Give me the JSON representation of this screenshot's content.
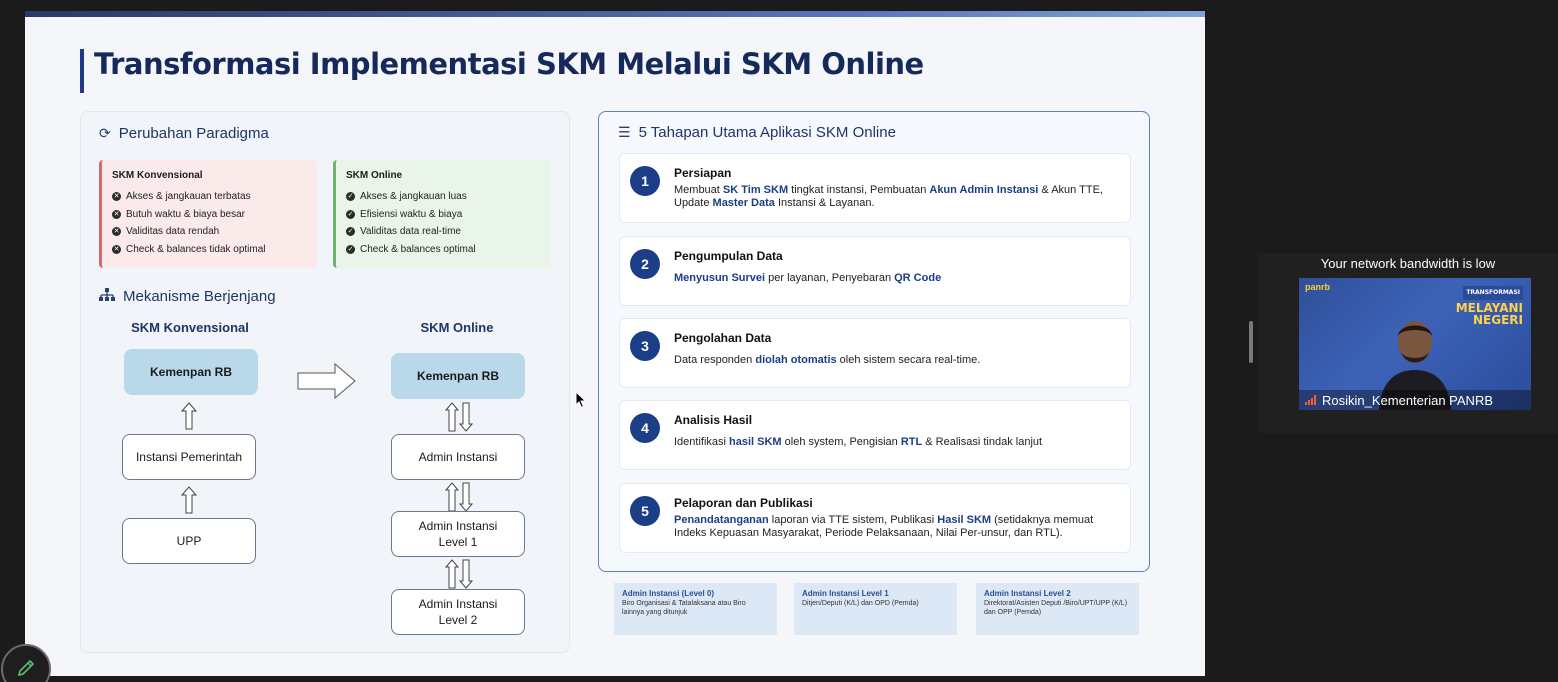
{
  "slide": {
    "title": "Transformasi Implementasi SKM Melalui SKM Online",
    "paradigm": {
      "heading": "Perubahan Paradigma",
      "konvensional": {
        "title": "SKM Konvensional",
        "items": [
          "Akses & jangkauan terbatas",
          "Butuh waktu & biaya besar",
          "Validitas data rendah",
          "Check & balances tidak optimal"
        ]
      },
      "online": {
        "title": "SKM Online",
        "items": [
          "Akses & jangkauan luas",
          "Efisiensi waktu & biaya",
          "Validitas data real-time",
          "Check & balances optimal"
        ]
      }
    },
    "mechanism": {
      "heading": "Mekanisme Berjenjang",
      "left_title": "SKM Konvensional",
      "right_title": "SKM Online",
      "left_boxes": [
        "Kemenpan RB",
        "Instansi Pemerintah",
        "UPP"
      ],
      "right_boxes": [
        "Kemenpan RB",
        "Admin Instansi",
        "Admin Instansi\nLevel 1",
        "Admin Instansi\nLevel 2"
      ]
    },
    "steps_heading": "5 Tahapan Utama Aplikasi SKM Online",
    "steps": [
      {
        "num": "1",
        "title": "Persiapan"
      },
      {
        "num": "2",
        "title": "Pengumpulan Data"
      },
      {
        "num": "3",
        "title": "Pengolahan Data"
      },
      {
        "num": "4",
        "title": "Analisis Hasil"
      },
      {
        "num": "5",
        "title": "Pelaporan dan Publikasi"
      }
    ],
    "step_desc": {
      "s1": {
        "a": "Membuat ",
        "b1": "SK Tim SKM",
        "c": " tingkat instansi, Pembuatan ",
        "b2": "Akun Admin Instansi",
        "d": " & Akun TTE, Update ",
        "b3": "Master Data",
        "e": " Instansi & Layanan."
      },
      "s2": {
        "b1": "Menyusun Survei",
        "a": " per layanan, Penyebaran ",
        "b2": "QR Code"
      },
      "s3": {
        "a": "Data responden ",
        "b1": "diolah otomatis",
        "c": " oleh sistem secara real-time."
      },
      "s4": {
        "a": "Identifikasi ",
        "b1": "hasil SKM",
        "c": " oleh system, Pengisian ",
        "b2": "RTL",
        "d": " & Realisasi tindak lanjut"
      },
      "s5": {
        "b1": "Penandatanganan",
        "a": " laporan via TTE sistem, Publikasi ",
        "b2": "Hasil SKM",
        "c": " (setidaknya memuat Indeks Kepuasan Masyarakat, Periode Pelaksanaan, Nilai Per-unsur, dan RTL)."
      }
    },
    "legend": [
      {
        "title": "Admin Instansi (Level 0)",
        "desc": "Biro Organisasi & Tatalaksana atau Biro lainnya yang ditunjuk"
      },
      {
        "title": "Admin Instansi Level 1",
        "desc": "Ditjen/Deputi (K/L) dan OPD (Pemda)"
      },
      {
        "title": "Admin Instansi Level 2",
        "desc": "Direktorat/Asisten Deputi /Biro/UPT/UPP (K/L) dan OPP (Pemda)"
      }
    ]
  },
  "video": {
    "notice": "Your network bandwidth is low",
    "participant": "Rosikin_Kementerian PANRB",
    "brand": "panrb",
    "slogan_tag": "TRANSFORMASI",
    "slogan_line1": "MELAYANI",
    "slogan_line2": "NEGERI"
  },
  "colors": {
    "accent": "#1b3e86",
    "title": "#15295a",
    "paradigm_red": "#d86a6a",
    "paradigm_green": "#6db56d"
  }
}
